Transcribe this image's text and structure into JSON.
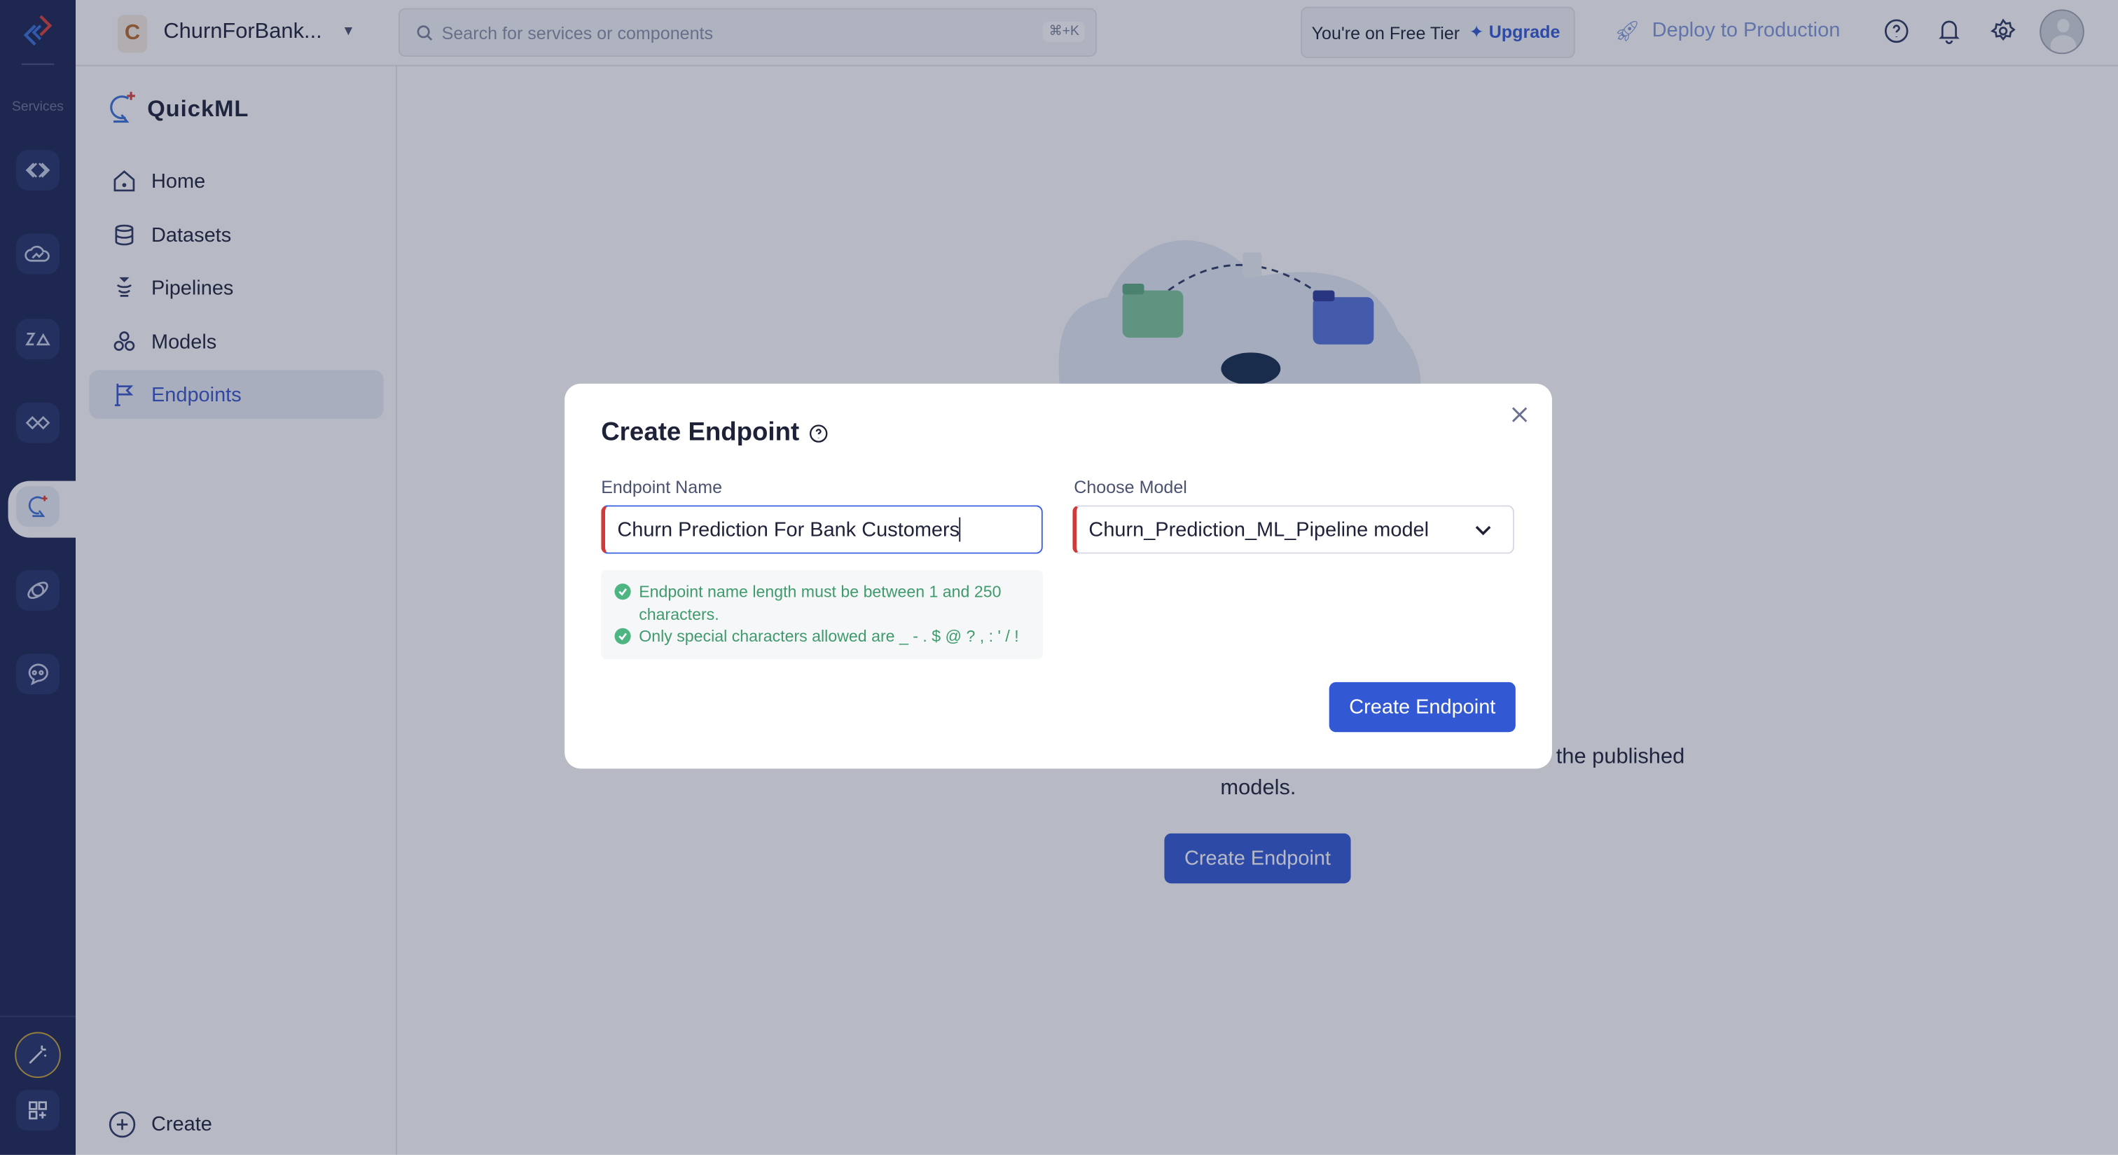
{
  "rail": {
    "services_label": "Services",
    "items": [
      "code-studio",
      "cloud-analytics",
      "zia",
      "integrations",
      "quickml",
      "link-service",
      "chatbot"
    ],
    "bottom": [
      "magic-wand",
      "apps-grid"
    ]
  },
  "topbar": {
    "project_initial": "C",
    "project_name": "ChurnForBank...",
    "search_placeholder": "Search for services or components",
    "search_shortcut": "⌘+K",
    "tier_text": "You're on Free Tier",
    "upgrade_label": "Upgrade",
    "deploy_label": "Deploy to Production"
  },
  "sidebar": {
    "title": "QuickML",
    "items": [
      {
        "label": "Home",
        "icon": "home-icon"
      },
      {
        "label": "Datasets",
        "icon": "database-icon"
      },
      {
        "label": "Pipelines",
        "icon": "pipeline-icon"
      },
      {
        "label": "Models",
        "icon": "models-icon"
      },
      {
        "label": "Endpoints",
        "icon": "flag-icon",
        "selected": true
      }
    ],
    "create_label": "Create"
  },
  "main": {
    "description_visible_end": "the published",
    "description_line2": "models.",
    "create_button": "Create Endpoint"
  },
  "modal": {
    "title": "Create Endpoint",
    "endpoint_name_label": "Endpoint Name",
    "endpoint_name_value": "Churn Prediction For Bank Customers",
    "choose_model_label": "Choose Model",
    "choose_model_value": "Churn_Prediction_ML_Pipeline model",
    "hints": [
      "Endpoint name length must be between 1 and 250 characters.",
      "Only special characters allowed are _ - . $ @ ? , : ' / !"
    ],
    "submit_label": "Create Endpoint"
  },
  "colors": {
    "primary": "#3358d4",
    "rail": "#1b2452",
    "success": "#3f9a6c",
    "required": "#d23a3a"
  }
}
